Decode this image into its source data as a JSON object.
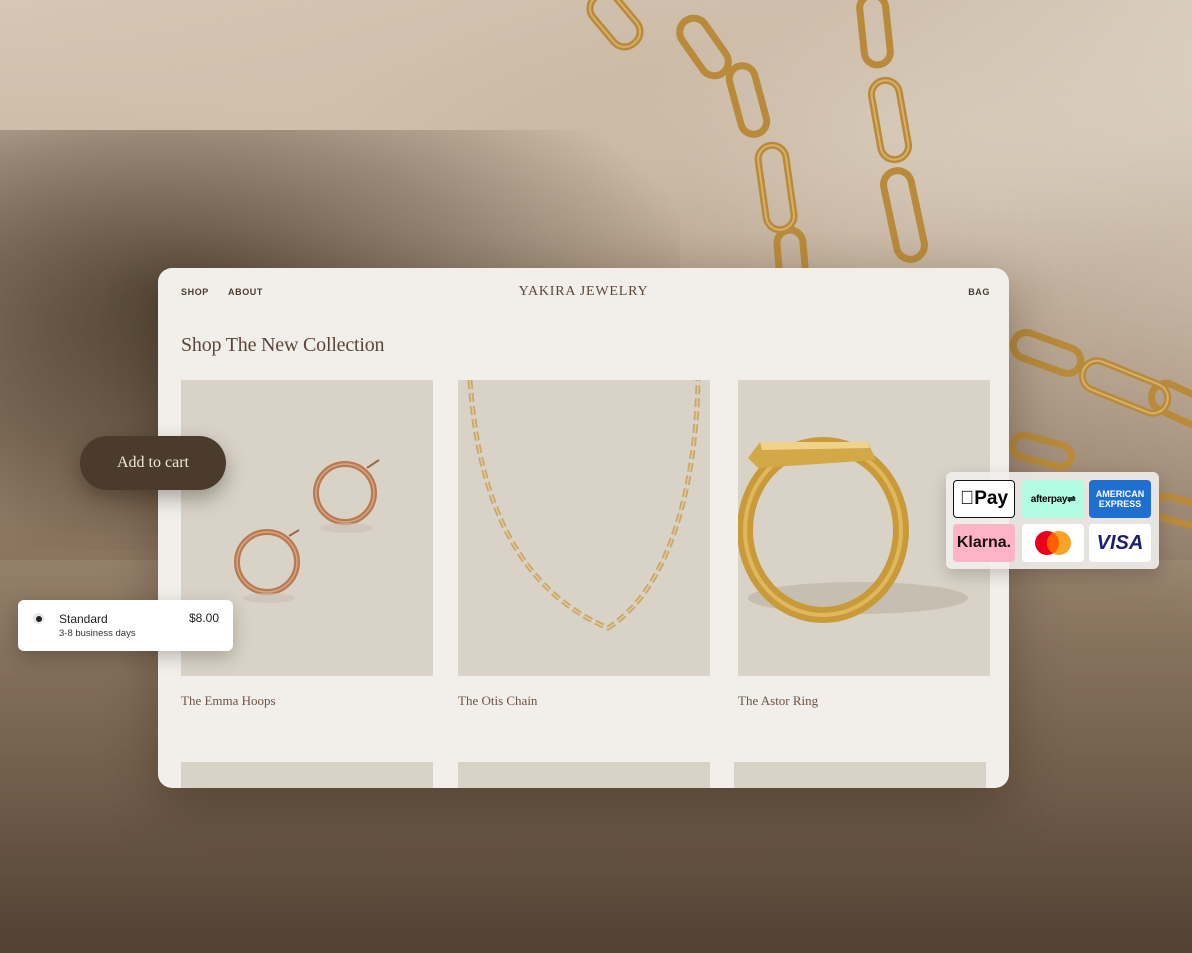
{
  "nav": {
    "shop": "SHOP",
    "about": "ABOUT",
    "brand": "YAKIRA JEWELRY",
    "bag": "BAG"
  },
  "collection_heading": "Shop The New Collection",
  "products": [
    {
      "name": "The Emma Hoops",
      "image": "rose-gold-hoop-earrings"
    },
    {
      "name": "The Otis Chain",
      "image": "gold-paperclip-chain-necklace"
    },
    {
      "name": "The Astor Ring",
      "image": "gold-signet-ring"
    }
  ],
  "add_to_cart": {
    "label": "Add to cart"
  },
  "shipping_option": {
    "name": "Standard",
    "days": "3-8 business days",
    "price": "$8.00",
    "selected": true
  },
  "payment_methods": {
    "apple_pay": "Pay",
    "afterpay": "afterpay",
    "amex_line1": "AMERICAN",
    "amex_line2": "EXPRESS",
    "klarna": "Klarna.",
    "visa": "VISA"
  },
  "colors": {
    "card_bg": "#f2efea",
    "product_bg": "#d9d3c7",
    "cart_button": "#4a3b2c",
    "text_brown": "#5a4638"
  }
}
